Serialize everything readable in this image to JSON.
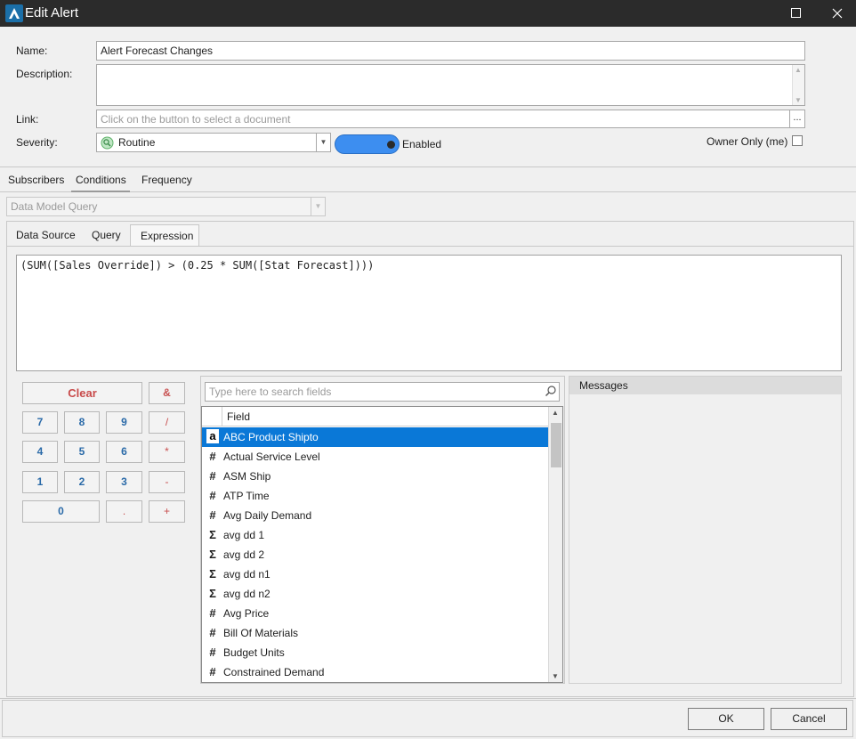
{
  "window": {
    "title": "Edit Alert"
  },
  "form": {
    "name_label": "Name:",
    "name_value": "Alert Forecast Changes",
    "description_label": "Description:",
    "description_value": "",
    "link_label": "Link:",
    "link_placeholder": "Click on the button to select a document",
    "link_button": "...",
    "severity_label": "Severity:",
    "severity_value": "Routine",
    "enabled_label": "Enabled",
    "enabled_on": true,
    "owner_only_label": "Owner Only (me)",
    "owner_only_checked": false
  },
  "main_tabs": [
    "Subscribers",
    "Conditions",
    "Frequency"
  ],
  "main_tab_active": "Conditions",
  "query_type": "Data Model Query",
  "sub_tabs": [
    "Data Source",
    "Query",
    "Expression"
  ],
  "sub_tab_active": "Expression",
  "expression": "(SUM([Sales Override]) > (0.25 * SUM([Stat Forecast])))",
  "calculator": {
    "clear": "Clear",
    "digits": [
      "7",
      "8",
      "9",
      "4",
      "5",
      "6",
      "1",
      "2",
      "3",
      "0",
      "."
    ],
    "operators": [
      "&",
      "/",
      "*",
      "-",
      "+"
    ]
  },
  "fields": {
    "search_placeholder": "Type here to search fields",
    "column_header": "Field",
    "rows": [
      {
        "icon": "a",
        "icon_name": "text-type-icon",
        "label": "ABC Product Shipto",
        "selected": true
      },
      {
        "icon": "#",
        "icon_name": "number-type-icon",
        "label": "Actual Service Level"
      },
      {
        "icon": "#",
        "icon_name": "number-type-icon",
        "label": "ASM Ship"
      },
      {
        "icon": "#",
        "icon_name": "number-type-icon",
        "label": "ATP Time"
      },
      {
        "icon": "#",
        "icon_name": "number-type-icon",
        "label": "Avg Daily Demand"
      },
      {
        "icon": "Σ",
        "icon_name": "sum-type-icon",
        "label": "avg dd 1"
      },
      {
        "icon": "Σ",
        "icon_name": "sum-type-icon",
        "label": "avg dd 2"
      },
      {
        "icon": "Σ",
        "icon_name": "sum-type-icon",
        "label": "avg dd n1"
      },
      {
        "icon": "Σ",
        "icon_name": "sum-type-icon",
        "label": "avg dd n2"
      },
      {
        "icon": "#",
        "icon_name": "number-type-icon",
        "label": "Avg Price"
      },
      {
        "icon": "#",
        "icon_name": "number-type-icon",
        "label": "Bill Of Materials"
      },
      {
        "icon": "#",
        "icon_name": "number-type-icon",
        "label": "Budget Units"
      },
      {
        "icon": "#",
        "icon_name": "number-type-icon",
        "label": "Constrained Demand"
      }
    ]
  },
  "messages": {
    "title": "Messages"
  },
  "buttons": {
    "ok": "OK",
    "cancel": "Cancel"
  },
  "colors": {
    "accent": "#0a78d7",
    "toggle": "#3d8ef0",
    "titlebar": "#2b2b2b"
  }
}
